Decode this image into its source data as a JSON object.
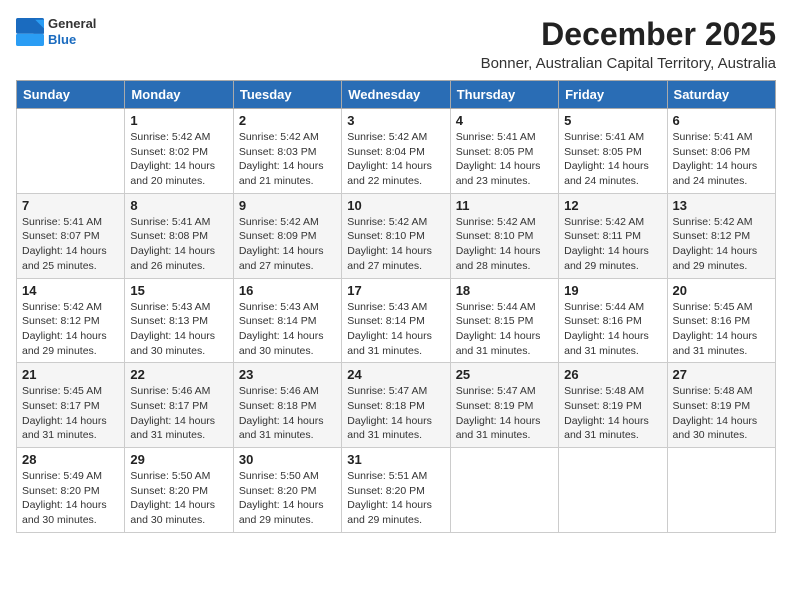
{
  "header": {
    "logo_line1": "General",
    "logo_line2": "Blue",
    "title": "December 2025",
    "subtitle": "Bonner, Australian Capital Territory, Australia"
  },
  "days_of_week": [
    "Sunday",
    "Monday",
    "Tuesday",
    "Wednesday",
    "Thursday",
    "Friday",
    "Saturday"
  ],
  "weeks": [
    [
      {
        "day": "",
        "detail": ""
      },
      {
        "day": "1",
        "detail": "Sunrise: 5:42 AM\nSunset: 8:02 PM\nDaylight: 14 hours\nand 20 minutes."
      },
      {
        "day": "2",
        "detail": "Sunrise: 5:42 AM\nSunset: 8:03 PM\nDaylight: 14 hours\nand 21 minutes."
      },
      {
        "day": "3",
        "detail": "Sunrise: 5:42 AM\nSunset: 8:04 PM\nDaylight: 14 hours\nand 22 minutes."
      },
      {
        "day": "4",
        "detail": "Sunrise: 5:41 AM\nSunset: 8:05 PM\nDaylight: 14 hours\nand 23 minutes."
      },
      {
        "day": "5",
        "detail": "Sunrise: 5:41 AM\nSunset: 8:05 PM\nDaylight: 14 hours\nand 24 minutes."
      },
      {
        "day": "6",
        "detail": "Sunrise: 5:41 AM\nSunset: 8:06 PM\nDaylight: 14 hours\nand 24 minutes."
      }
    ],
    [
      {
        "day": "7",
        "detail": "Sunrise: 5:41 AM\nSunset: 8:07 PM\nDaylight: 14 hours\nand 25 minutes."
      },
      {
        "day": "8",
        "detail": "Sunrise: 5:41 AM\nSunset: 8:08 PM\nDaylight: 14 hours\nand 26 minutes."
      },
      {
        "day": "9",
        "detail": "Sunrise: 5:42 AM\nSunset: 8:09 PM\nDaylight: 14 hours\nand 27 minutes."
      },
      {
        "day": "10",
        "detail": "Sunrise: 5:42 AM\nSunset: 8:10 PM\nDaylight: 14 hours\nand 27 minutes."
      },
      {
        "day": "11",
        "detail": "Sunrise: 5:42 AM\nSunset: 8:10 PM\nDaylight: 14 hours\nand 28 minutes."
      },
      {
        "day": "12",
        "detail": "Sunrise: 5:42 AM\nSunset: 8:11 PM\nDaylight: 14 hours\nand 29 minutes."
      },
      {
        "day": "13",
        "detail": "Sunrise: 5:42 AM\nSunset: 8:12 PM\nDaylight: 14 hours\nand 29 minutes."
      }
    ],
    [
      {
        "day": "14",
        "detail": "Sunrise: 5:42 AM\nSunset: 8:12 PM\nDaylight: 14 hours\nand 29 minutes."
      },
      {
        "day": "15",
        "detail": "Sunrise: 5:43 AM\nSunset: 8:13 PM\nDaylight: 14 hours\nand 30 minutes."
      },
      {
        "day": "16",
        "detail": "Sunrise: 5:43 AM\nSunset: 8:14 PM\nDaylight: 14 hours\nand 30 minutes."
      },
      {
        "day": "17",
        "detail": "Sunrise: 5:43 AM\nSunset: 8:14 PM\nDaylight: 14 hours\nand 31 minutes."
      },
      {
        "day": "18",
        "detail": "Sunrise: 5:44 AM\nSunset: 8:15 PM\nDaylight: 14 hours\nand 31 minutes."
      },
      {
        "day": "19",
        "detail": "Sunrise: 5:44 AM\nSunset: 8:16 PM\nDaylight: 14 hours\nand 31 minutes."
      },
      {
        "day": "20",
        "detail": "Sunrise: 5:45 AM\nSunset: 8:16 PM\nDaylight: 14 hours\nand 31 minutes."
      }
    ],
    [
      {
        "day": "21",
        "detail": "Sunrise: 5:45 AM\nSunset: 8:17 PM\nDaylight: 14 hours\nand 31 minutes."
      },
      {
        "day": "22",
        "detail": "Sunrise: 5:46 AM\nSunset: 8:17 PM\nDaylight: 14 hours\nand 31 minutes."
      },
      {
        "day": "23",
        "detail": "Sunrise: 5:46 AM\nSunset: 8:18 PM\nDaylight: 14 hours\nand 31 minutes."
      },
      {
        "day": "24",
        "detail": "Sunrise: 5:47 AM\nSunset: 8:18 PM\nDaylight: 14 hours\nand 31 minutes."
      },
      {
        "day": "25",
        "detail": "Sunrise: 5:47 AM\nSunset: 8:19 PM\nDaylight: 14 hours\nand 31 minutes."
      },
      {
        "day": "26",
        "detail": "Sunrise: 5:48 AM\nSunset: 8:19 PM\nDaylight: 14 hours\nand 31 minutes."
      },
      {
        "day": "27",
        "detail": "Sunrise: 5:48 AM\nSunset: 8:19 PM\nDaylight: 14 hours\nand 30 minutes."
      }
    ],
    [
      {
        "day": "28",
        "detail": "Sunrise: 5:49 AM\nSunset: 8:20 PM\nDaylight: 14 hours\nand 30 minutes."
      },
      {
        "day": "29",
        "detail": "Sunrise: 5:50 AM\nSunset: 8:20 PM\nDaylight: 14 hours\nand 30 minutes."
      },
      {
        "day": "30",
        "detail": "Sunrise: 5:50 AM\nSunset: 8:20 PM\nDaylight: 14 hours\nand 29 minutes."
      },
      {
        "day": "31",
        "detail": "Sunrise: 5:51 AM\nSunset: 8:20 PM\nDaylight: 14 hours\nand 29 minutes."
      },
      {
        "day": "",
        "detail": ""
      },
      {
        "day": "",
        "detail": ""
      },
      {
        "day": "",
        "detail": ""
      }
    ]
  ]
}
